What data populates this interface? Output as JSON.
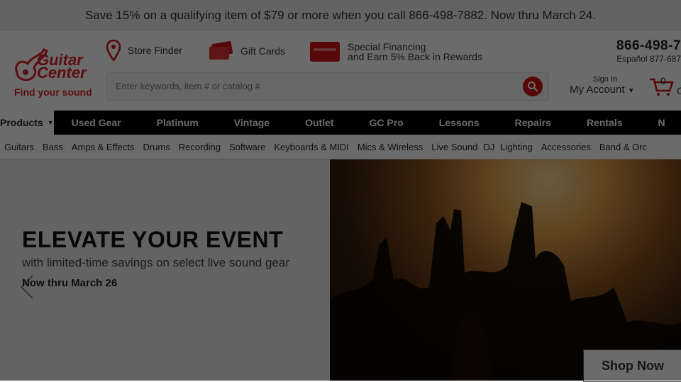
{
  "promo_banner": "Save 15% on a qualifying item of $79 or more when you call 866-498-7882. Now thru March 24.",
  "logo": {
    "wordmark": "Guitar Center",
    "tagline": "Find your sound"
  },
  "header_links": {
    "store_finder": "Store Finder",
    "gift_cards": "Gift Cards",
    "financing_line1": "Special Financing",
    "financing_line2": "and Earn 5% Back in Rewards"
  },
  "search": {
    "placeholder": "Enter keywords, item # or catalog #"
  },
  "phone": {
    "main": "866-498-7",
    "espanol": "Español 877-687"
  },
  "account": {
    "sign_in": "Sign In",
    "label": "My Account"
  },
  "cart": {
    "count": "0",
    "label": "C"
  },
  "nav": {
    "products": "Products",
    "items": [
      "Used Gear",
      "Platinum",
      "Vintage",
      "Outlet",
      "GC Pro",
      "Lessons",
      "Repairs",
      "Rentals",
      "N"
    ]
  },
  "subnav": [
    "Guitars",
    "Bass",
    "Amps & Effects",
    "Drums",
    "Recording",
    "Software",
    "Keyboards & MIDI",
    "Mics & Wireless",
    "Live Sound",
    "DJ",
    "Lighting",
    "Accessories",
    "Band & Orc"
  ],
  "hero": {
    "title": "ELEVATE YOUR EVENT",
    "subtitle": "with limited-time savings on select live sound gear",
    "date": "Now thru March 26",
    "cta": "Shop Now"
  },
  "colors": {
    "brand_red": "#cc1111",
    "nav_bg": "#000000",
    "overlay": "rgba(0,0,0,0.58)"
  }
}
